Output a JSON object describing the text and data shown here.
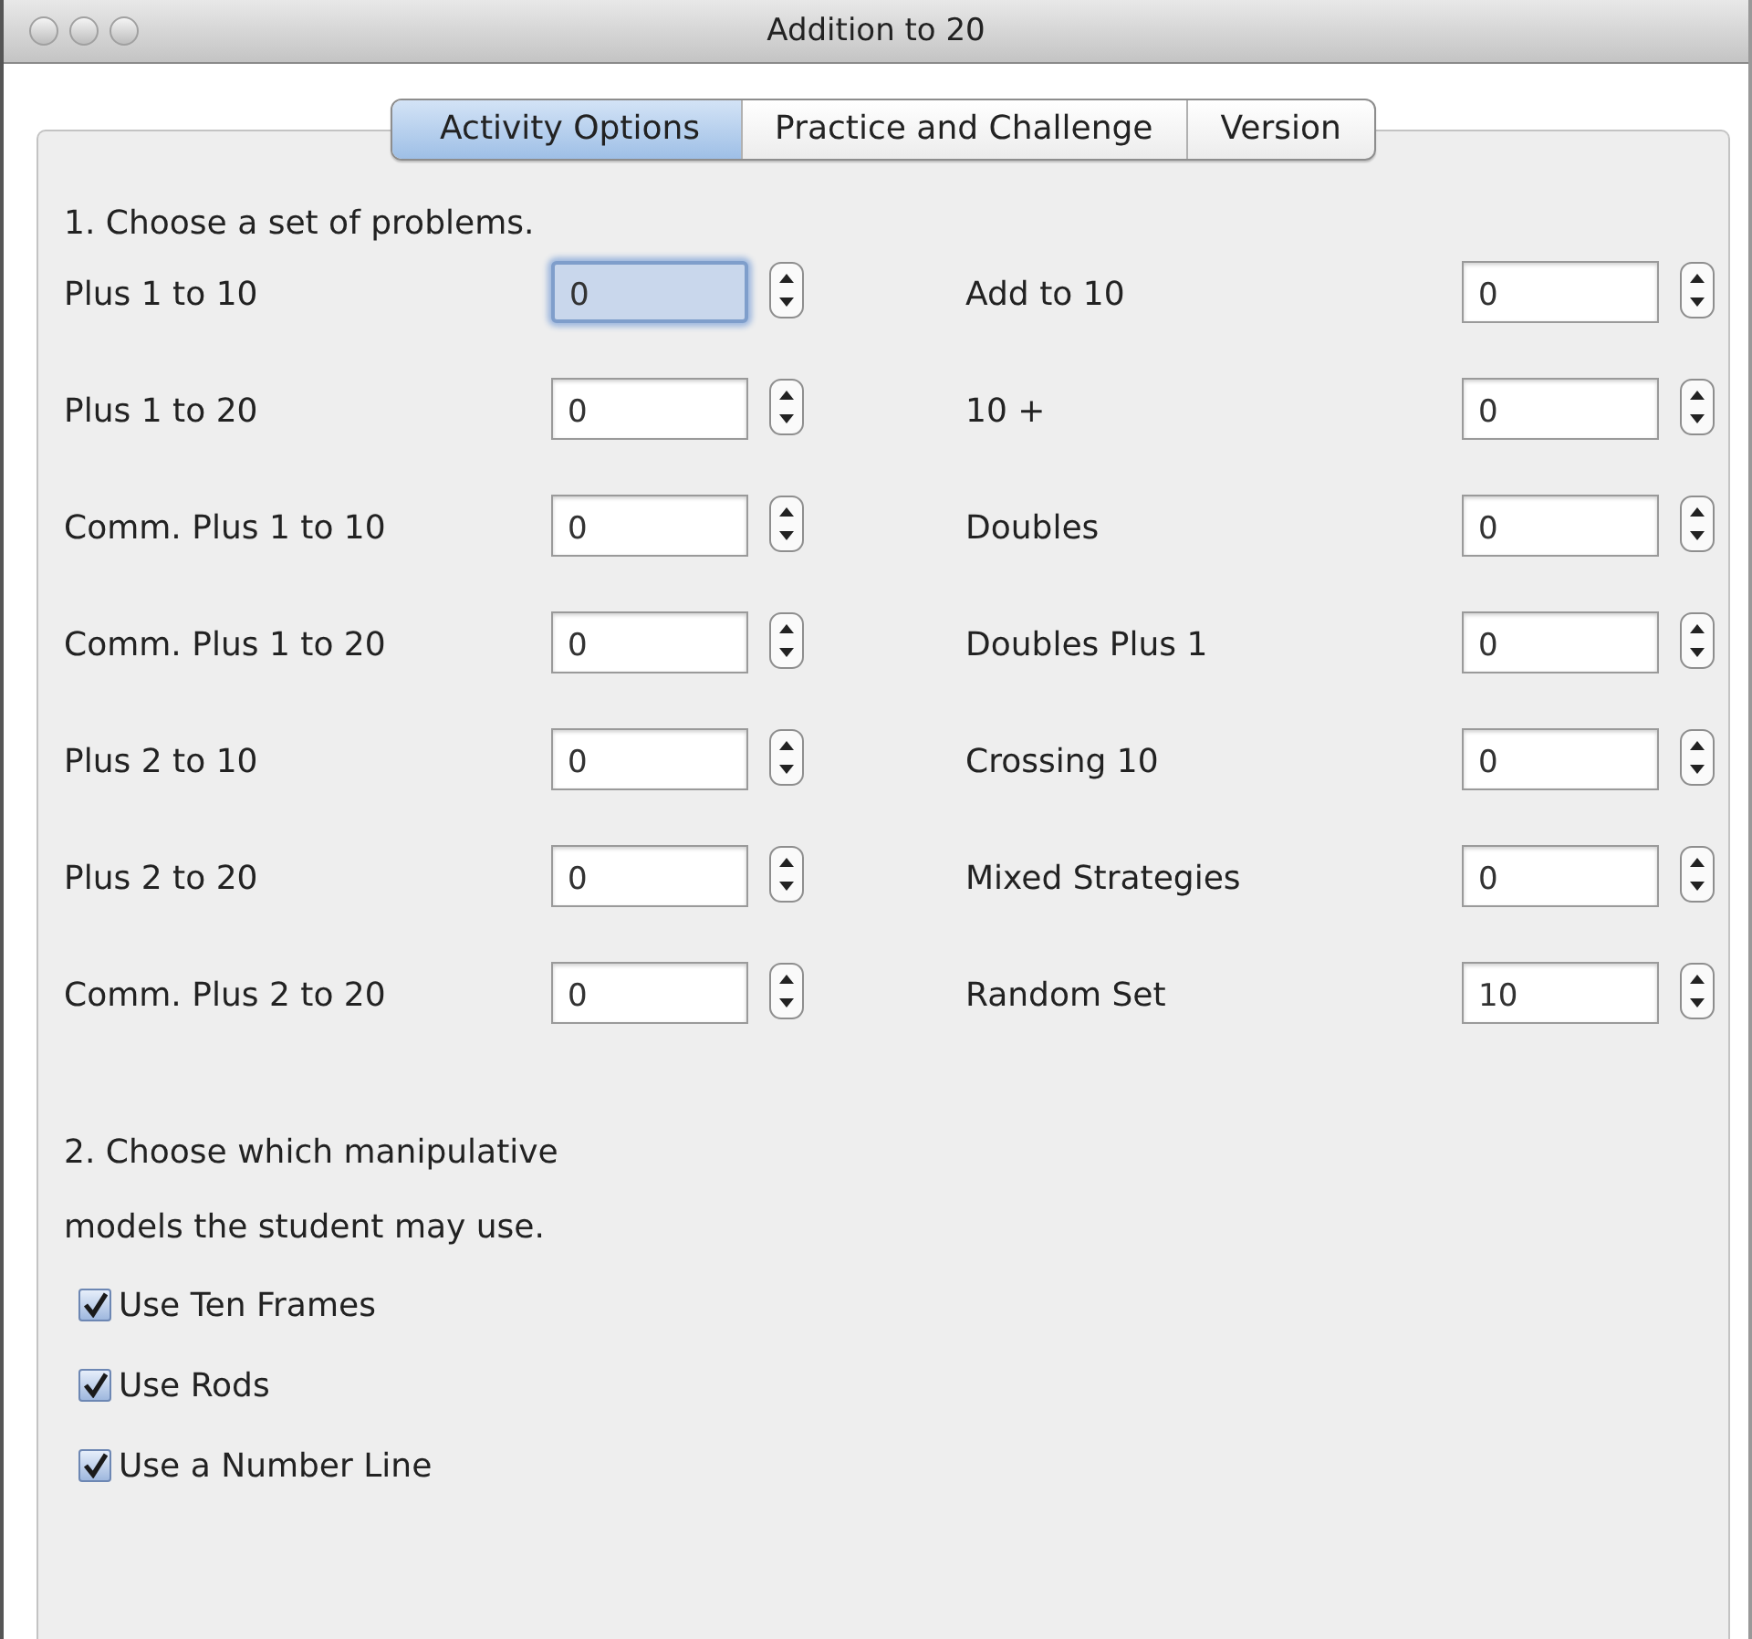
{
  "window": {
    "title": "Addition to 20"
  },
  "tabs": [
    {
      "label": "Activity Options",
      "selected": true
    },
    {
      "label": "Practice and Challenge",
      "selected": false
    },
    {
      "label": "Version",
      "selected": false
    }
  ],
  "section_1": {
    "heading": "1.  Choose a set of problems.",
    "left_column": [
      {
        "label": "Plus 1 to 10",
        "value": "0",
        "focused": true
      },
      {
        "label": "Plus 1 to 20",
        "value": "0",
        "focused": false
      },
      {
        "label": "Comm. Plus 1 to 10",
        "value": "0",
        "focused": false
      },
      {
        "label": "Comm. Plus 1 to 20",
        "value": "0",
        "focused": false
      },
      {
        "label": "Plus 2 to 10",
        "value": "0",
        "focused": false
      },
      {
        "label": "Plus 2 to 20",
        "value": "0",
        "focused": false
      },
      {
        "label": "Comm. Plus 2 to 20",
        "value": "0",
        "focused": false
      }
    ],
    "right_column": [
      {
        "label": "Add to 10",
        "value": "0",
        "focused": false
      },
      {
        "label": "10 +",
        "value": "0",
        "focused": false
      },
      {
        "label": "Doubles",
        "value": "0",
        "focused": false
      },
      {
        "label": "Doubles Plus 1",
        "value": "0",
        "focused": false
      },
      {
        "label": "Crossing 10",
        "value": "0",
        "focused": false
      },
      {
        "label": "Mixed Strategies",
        "value": "0",
        "focused": false
      },
      {
        "label": "Random Set",
        "value": "10",
        "focused": false
      }
    ]
  },
  "section_2": {
    "heading_lines": [
      "2.  Choose which manipulative",
      "models the student may use."
    ],
    "options": [
      {
        "label": "Use Ten Frames",
        "checked": true
      },
      {
        "label": "Use Rods",
        "checked": true
      },
      {
        "label": "Use a Number Line",
        "checked": true
      }
    ]
  }
}
